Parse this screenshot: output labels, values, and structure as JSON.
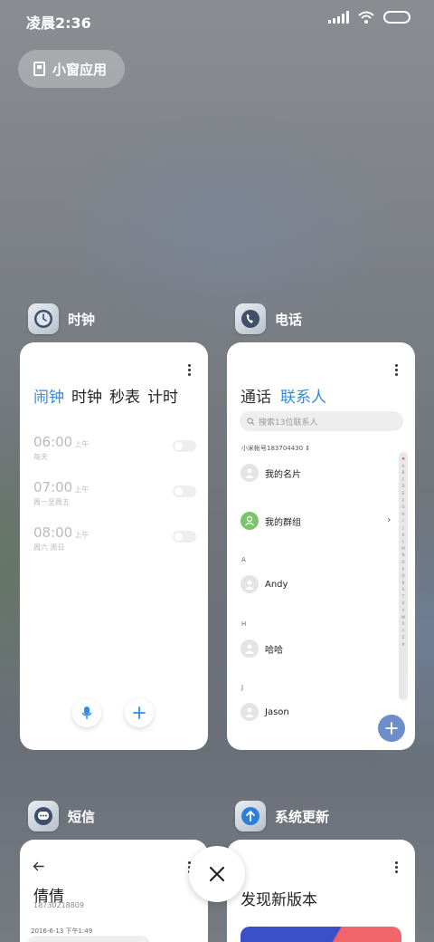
{
  "status_bar": {
    "time": "凌晨2:36"
  },
  "small_window": {
    "label": "小窗应用"
  },
  "cards": {
    "clock": {
      "app_name": "时钟",
      "tabs": [
        "闹钟",
        "时钟",
        "秒表",
        "计时"
      ],
      "alarms": [
        {
          "time": "06:00",
          "ampm": "上午",
          "repeat": "每天",
          "enabled": false
        },
        {
          "time": "07:00",
          "ampm": "上午",
          "repeat": "周一至周五",
          "enabled": false
        },
        {
          "time": "08:00",
          "ampm": "上午",
          "repeat": "周六 周日",
          "enabled": false
        }
      ]
    },
    "phone": {
      "app_name": "电话",
      "tabs": [
        "通话",
        "联系人"
      ],
      "search_placeholder": "搜索13位联系人",
      "account": "小米帐号183704430",
      "contacts": {
        "my_card": "我的名片",
        "my_groups": "我的群组",
        "section_a": "A",
        "andy": "Andy",
        "section_h": "H",
        "haha": "哈哈",
        "section_j": "J",
        "jason": "Jason"
      },
      "alpha_index": [
        "A",
        "B",
        "C",
        "D",
        "E",
        "F",
        "G",
        "H",
        "I",
        "J",
        "K",
        "L",
        "M",
        "N",
        "O",
        "P",
        "Q",
        "R",
        "S",
        "T",
        "U",
        "V",
        "W",
        "X",
        "Y",
        "Z",
        "#"
      ]
    },
    "sms": {
      "app_name": "短信",
      "contact_name": "倩倩",
      "contact_number": "18730218809",
      "date": "2016-6-13 下午1:49"
    },
    "update": {
      "app_name": "系统更新",
      "title": "发现新版本"
    }
  },
  "colors": {
    "accent": "#2f8be6",
    "fab": "#6d8ec9",
    "group_avatar": "#7ac46a"
  }
}
